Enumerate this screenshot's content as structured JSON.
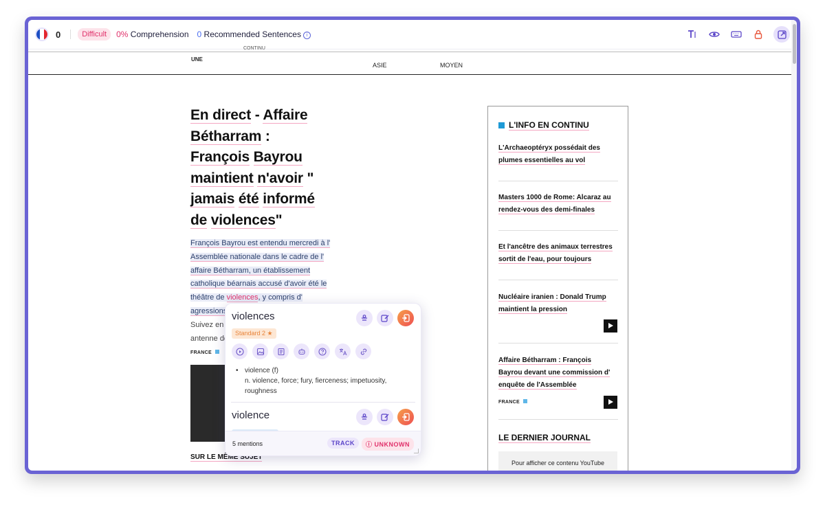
{
  "toolbar": {
    "known_count": "0",
    "difficulty": "Difficult",
    "comprehension_pct": "0%",
    "comprehension_label": "Comprehension",
    "recommended_count": "0",
    "recommended_label": "Recommended Sentences",
    "flag_colors": [
      "#1d4fc4",
      "#ffffff",
      "#e3262f"
    ]
  },
  "nav": {
    "item1": "UNE",
    "item2": "ASIE",
    "item3": "MOYEN",
    "top_cut": "CONTINU"
  },
  "article": {
    "headline": {
      "w1": "En direct",
      "s1": " - ",
      "w2": "Affaire",
      "w3": "Bétharram",
      "s3": " :",
      "w4": "François",
      "s4": " ",
      "w5": "Bayrou",
      "w6": "maintient",
      "s6": " ",
      "w7": "n'avoir",
      "s7": " \"",
      "w8": "jamais",
      "s8": " ",
      "w9": "été",
      "s9": " ",
      "w10": "informé",
      "w11": "de",
      "s11": " ",
      "w12": "violences",
      "s12": "\""
    },
    "lead": {
      "l1": "François Bayrou est entendu mercredi à l'",
      "l2": "Assemblée nationale dans le cadre de l'",
      "l3": "affaire Bétharram, un établissement",
      "l4": "catholique béarnais accusé d'avoir été le",
      "l5a": "théâtre de ",
      "l5b": "violences",
      "l5c": ", y compris d'",
      "l6": "agressions",
      "l7": "Suivez en d",
      "l8": "antenne de"
    },
    "tag": "FRANCE",
    "same_subject": "SUR LE MÊME SUJET"
  },
  "sidebar": {
    "title": "L'INFO EN CONTINU",
    "items": [
      {
        "l1": "L'Archaeoptéryx possédait des",
        "l2": "plumes essentielles au vol"
      },
      {
        "l1": "Masters 1000 de Rome: Alcaraz au",
        "l2": "rendez-vous des demi-finales"
      },
      {
        "l1": "Et l'ancêtre des animaux terrestres",
        "l2": " sortit de l'eau, pour toujours"
      },
      {
        "l1": "Nucléaire iranien : Donald Trump",
        "l2": "maintient la pression"
      },
      {
        "l1": "Affaire Bétharram : François",
        "l2": "Bayrou devant une commission d'",
        "l3": "enquête de l'Assemblée",
        "tag": "FRANCE"
      }
    ],
    "journal_title": "LE DERNIER JOURNAL",
    "youtube_text": "Pour afficher ce contenu YouTube"
  },
  "popup": {
    "word": "violences",
    "level": "Standard 2 ★",
    "definition_l1": "violence (f)",
    "definition_l2": "n. violence, force; fury, fierceness; impetuosity,",
    "definition_l3": "roughness",
    "word2": "violence",
    "mentions": "5 mentions",
    "track_label": "TRACK",
    "unknown_label": "UNKNOWN"
  }
}
